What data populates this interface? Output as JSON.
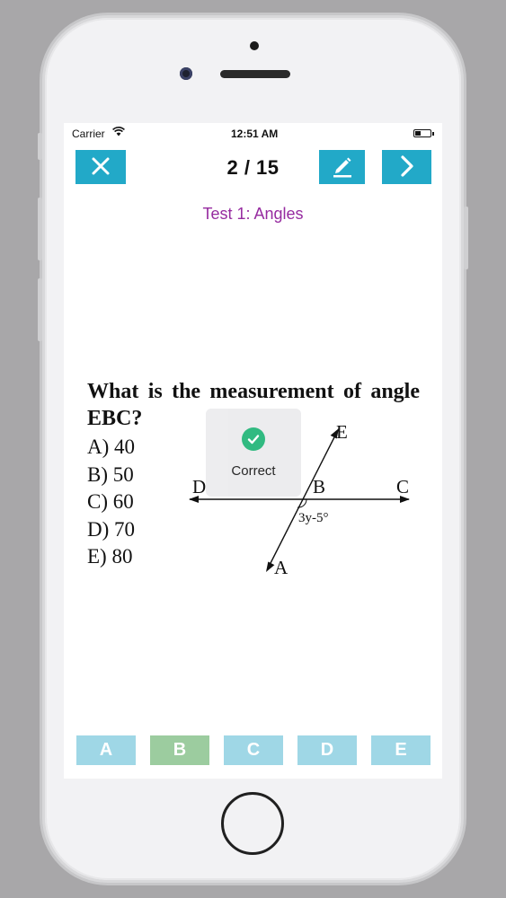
{
  "status_bar": {
    "carrier": "Carrier",
    "time": "12:51 AM"
  },
  "header": {
    "progress": "2 / 15",
    "test_title": "Test 1: Angles"
  },
  "icons": {
    "close": "close-x-icon",
    "edit": "pencil-edit-icon",
    "next": "chevron-right-icon",
    "correct": "checkmark-circle-icon"
  },
  "question": {
    "text": "What is the measurement of angle EBC?",
    "choices": [
      "A) 40",
      "B) 50",
      "C) 60",
      "D) 70",
      "E) 80"
    ]
  },
  "diagram": {
    "point_labels": {
      "D": "D",
      "B": "B",
      "C": "C",
      "E": "E",
      "A": "A"
    },
    "angle_label": "3y-5°"
  },
  "toast": {
    "text": "Correct"
  },
  "answer_buttons": [
    {
      "label": "A",
      "color": "#9fd7e6"
    },
    {
      "label": "B",
      "color": "#9ccc9f"
    },
    {
      "label": "C",
      "color": "#9fd7e6"
    },
    {
      "label": "D",
      "color": "#9fd7e6"
    },
    {
      "label": "E",
      "color": "#9fd7e6"
    }
  ],
  "colors": {
    "accent": "#22a9c8",
    "title": "#962ba0",
    "success": "#2bb87d"
  }
}
